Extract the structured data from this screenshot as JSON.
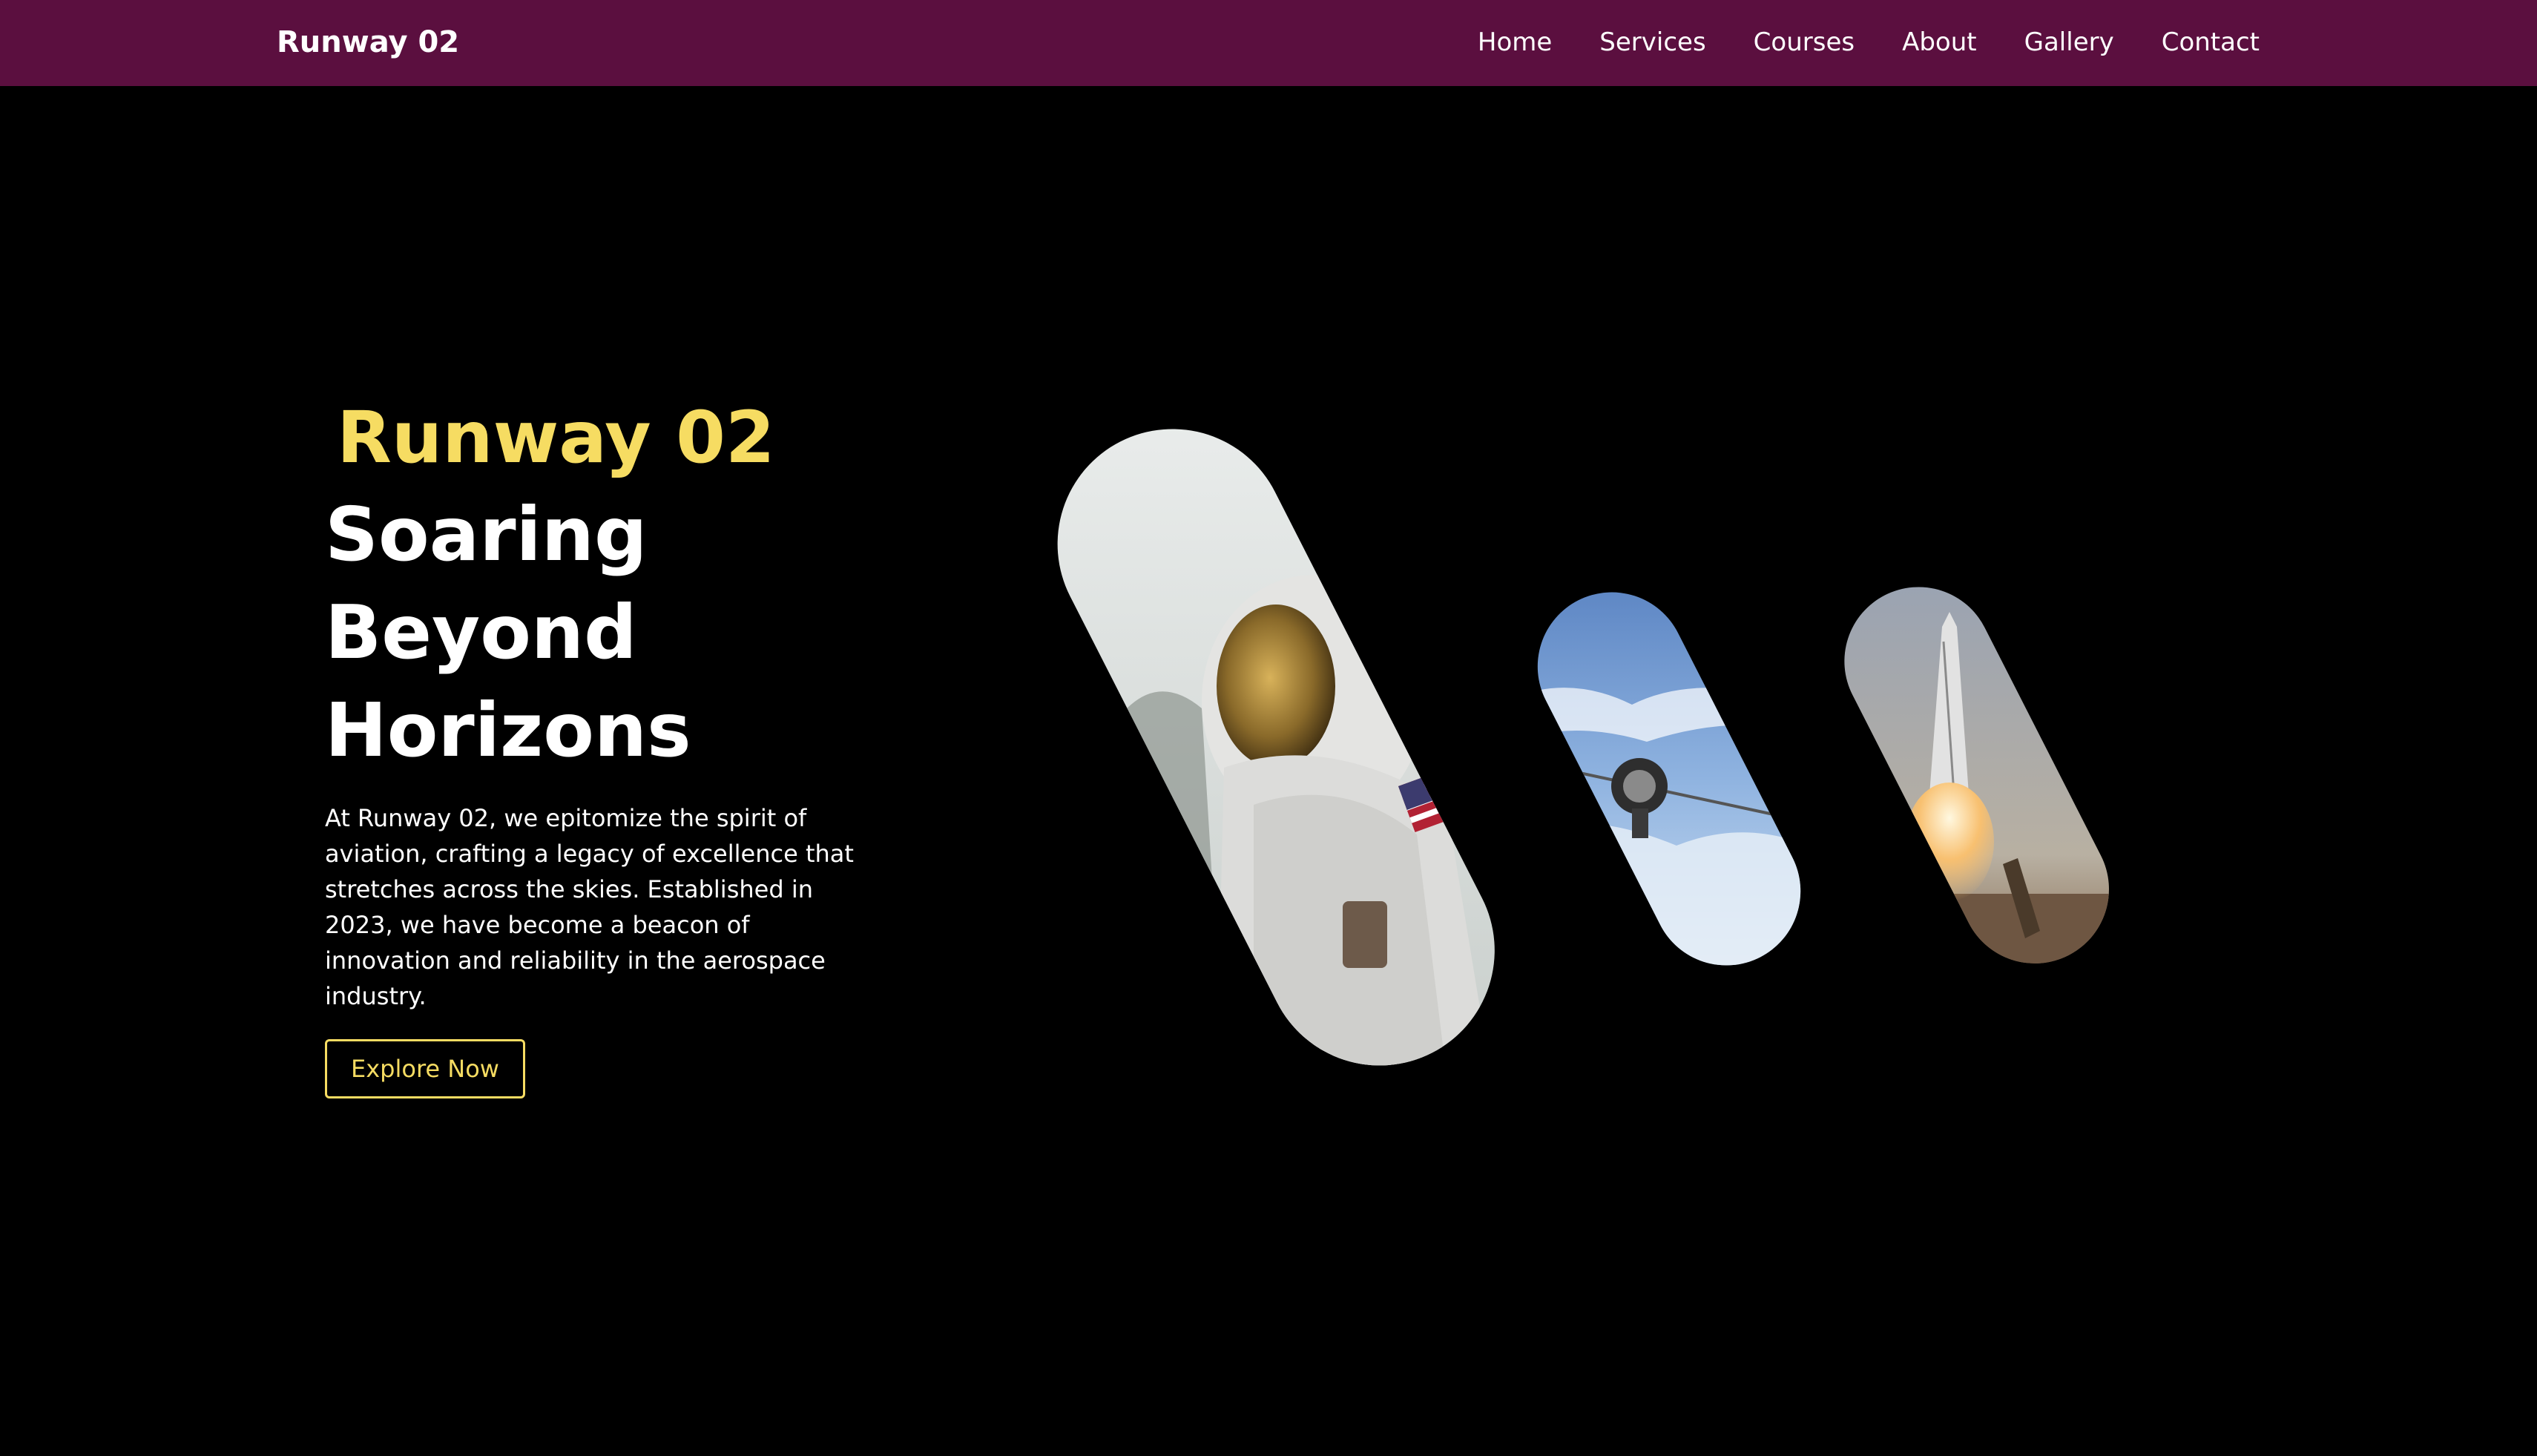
{
  "nav": {
    "brand": "Runway 02",
    "links": [
      "Home",
      "Services",
      "Courses",
      "About",
      "Gallery",
      "Contact"
    ]
  },
  "hero": {
    "brand": "Runway 02",
    "title_lines": [
      "Soaring",
      "Beyond",
      "Horizons"
    ],
    "description": "At Runway 02, we epitomize the spirit of aviation, crafting a legacy of excellence that stretches across the skies. Established in 2023, we have become a beacon of innovation and reliability in the aerospace industry.",
    "cta_label": "Explore Now"
  },
  "colors": {
    "navbar_bg": "#5b0f3f",
    "page_bg": "#000000",
    "accent": "#f6dc62",
    "text": "#ffffff"
  },
  "gallery": {
    "images": [
      "astronaut-image",
      "spacecraft-image",
      "rocket-launch-image"
    ]
  }
}
